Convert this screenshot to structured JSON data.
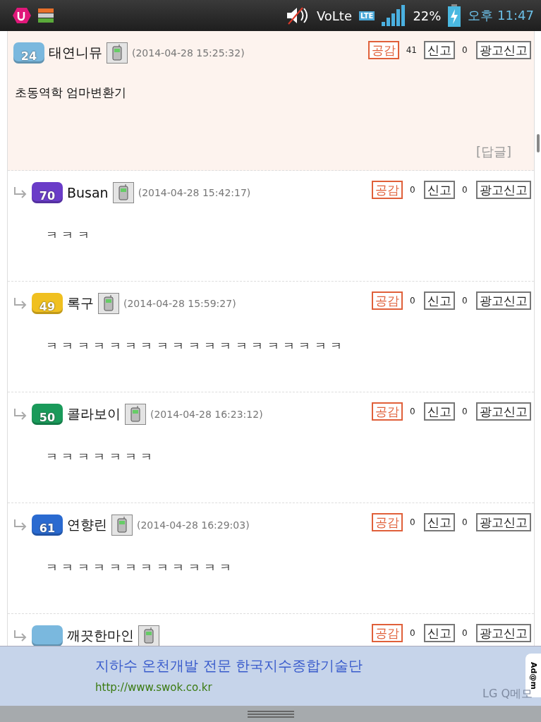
{
  "status_bar": {
    "volte": "VoLte",
    "network": "LTE",
    "battery": "22%",
    "time": "오후 11:47"
  },
  "comments": [
    {
      "kind": "comment",
      "level": "24",
      "color": "#7ab8de",
      "name": "태연니뮤",
      "date": "(2014-04-28 15:25:32)",
      "like": "공감",
      "like_count": "41",
      "report": "신고",
      "report_count": "0",
      "ad_report": "광고신고",
      "body": "초동역학 엄마변환기",
      "reply": "[답글]",
      "highlighted": true
    },
    {
      "kind": "reply",
      "level": "70",
      "color": "#6a3cc8",
      "name": "Busan",
      "date": "(2014-04-28 15:42:17)",
      "like": "공감",
      "like_count": "0",
      "report": "신고",
      "report_count": "0",
      "ad_report": "광고신고",
      "body": "ㅋ ㅋ ㅋ",
      "highlighted": false
    },
    {
      "kind": "reply",
      "level": "49",
      "color": "#f0c020",
      "name": "록구",
      "date": "(2014-04-28 15:59:27)",
      "like": "공감",
      "like_count": "0",
      "report": "신고",
      "report_count": "0",
      "ad_report": "광고신고",
      "body": "ㅋ ㅋ ㅋ ㅋ ㅋ ㅋ ㅋ ㅋ ㅋ ㅋ ㅋ ㅋ ㅋ ㅋ ㅋ ㅋ ㅋ ㅋ ㅋ",
      "highlighted": false
    },
    {
      "kind": "reply",
      "level": "50",
      "color": "#1a9a5a",
      "name": "콜라보이",
      "date": "(2014-04-28 16:23:12)",
      "like": "공감",
      "like_count": "0",
      "report": "신고",
      "report_count": "0",
      "ad_report": "광고신고",
      "body": "ㅋ ㅋ ㅋ ㅋ ㅋ ㅋ ㅋ",
      "highlighted": false
    },
    {
      "kind": "reply",
      "level": "61",
      "color": "#2a6ad0",
      "name": "연향린",
      "date": "(2014-04-28 16:29:03)",
      "like": "공감",
      "like_count": "0",
      "report": "신고",
      "report_count": "0",
      "ad_report": "광고신고",
      "body": "ㅋ ㅋ ㅋ ㅋ ㅋ ㅋ ㅋ ㅋ ㅋ ㅋ ㅋ ㅋ",
      "highlighted": false
    },
    {
      "kind": "reply",
      "color": "#7ab8de",
      "name": "깨끗한마인",
      "like": "공감",
      "like_count": "0",
      "report": "신고",
      "report_count": "0",
      "ad_report": "광고신고",
      "highlighted": false
    }
  ],
  "ad": {
    "title": "지하수 온천개발 전문 한국지수종합기술단",
    "url": "http://www.swok.co.kr",
    "badge": "Ad@m"
  },
  "qmemo": "LG Q메모"
}
